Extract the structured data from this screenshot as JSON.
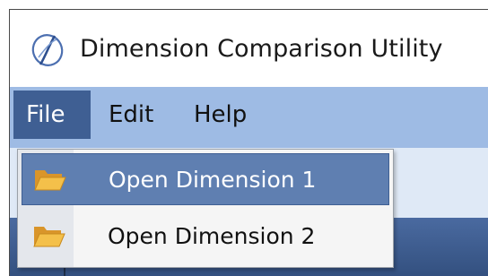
{
  "window": {
    "title": "Dimension Comparison Utility",
    "app_icon": "dimension-logo-icon"
  },
  "menu_bar": {
    "items": [
      {
        "label": "File",
        "active": true
      },
      {
        "label": "Edit",
        "active": false
      },
      {
        "label": "Help",
        "active": false
      }
    ]
  },
  "file_menu": {
    "items": [
      {
        "label": "Open Dimension 1",
        "icon": "folder-open-icon",
        "highlighted": true
      },
      {
        "label": "Open Dimension 2",
        "icon": "folder-open-icon",
        "highlighted": false
      }
    ]
  },
  "colors": {
    "menu_bar": "#9ebbe4",
    "menu_active": "#3f5f93",
    "item_highlight": "#5f7fb1",
    "folder": "#f0b429"
  }
}
